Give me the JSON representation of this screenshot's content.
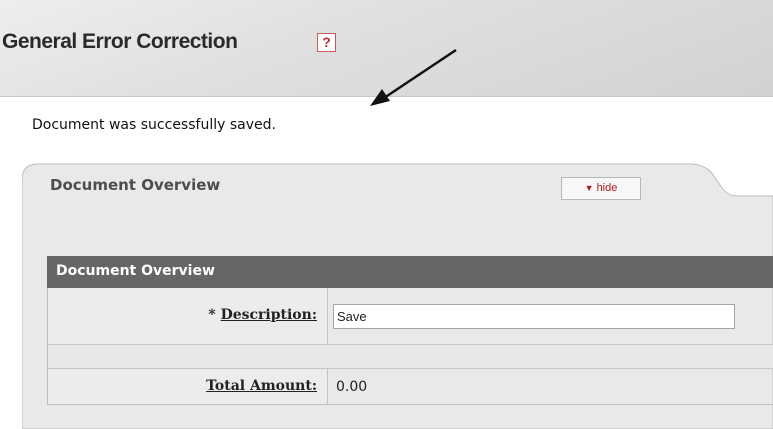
{
  "page": {
    "title": "General Error Correction",
    "help_icon": "?"
  },
  "message": "Document was successfully saved.",
  "tab": {
    "label": "Document Overview",
    "toggle_label": "hide",
    "toggle_icon": "▼"
  },
  "section": {
    "title": "Document Overview",
    "fields": {
      "description": {
        "required_marker": "*",
        "label": "Description:",
        "value": "Save"
      },
      "total_amount": {
        "label": "Total Amount:",
        "value": "0.00"
      }
    }
  },
  "colors": {
    "section_bar": "#666666",
    "help_border": "#c85a5a",
    "hide_text": "#a81c1c"
  }
}
